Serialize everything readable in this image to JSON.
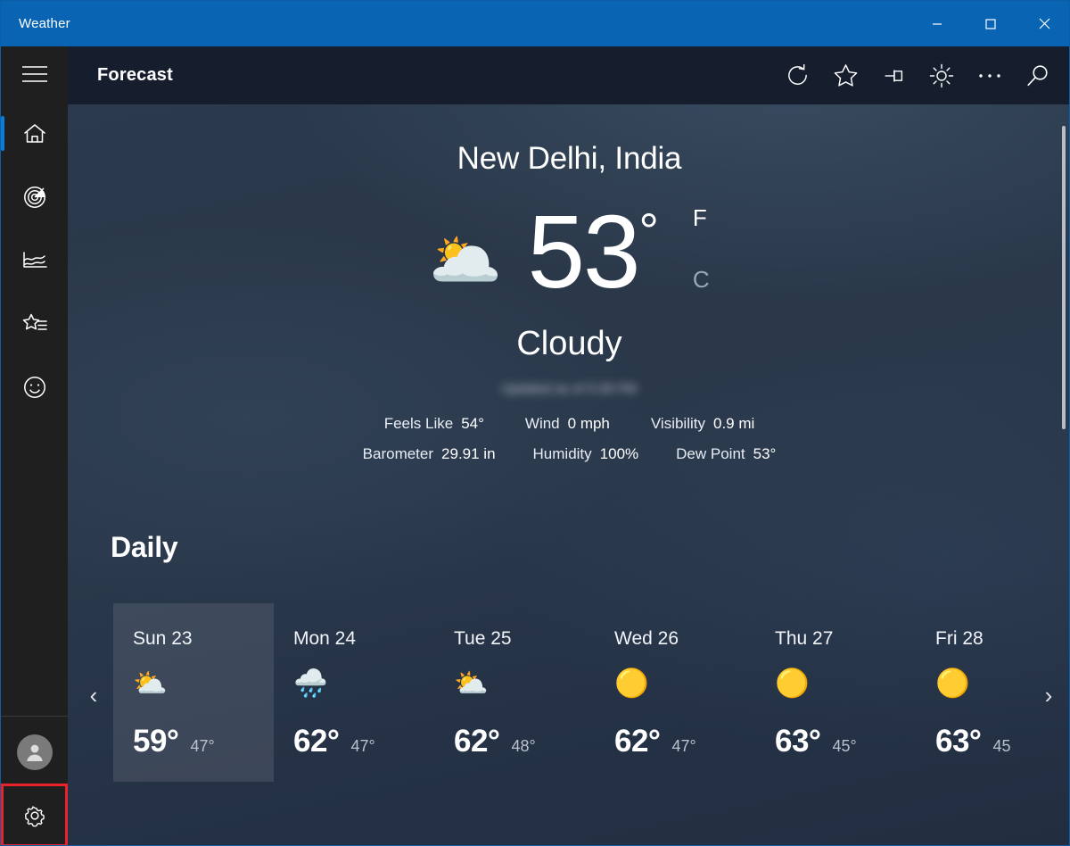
{
  "window": {
    "title": "Weather",
    "controls": [
      {
        "name": "minimize-button",
        "label": "—"
      },
      {
        "name": "maximize-button",
        "label": "□"
      },
      {
        "name": "close-button",
        "label": "✕"
      }
    ]
  },
  "rail": {
    "menu_label": "Menu",
    "items": [
      {
        "icon": "home-icon",
        "label": "Forecast",
        "active": true
      },
      {
        "icon": "radar-icon",
        "label": "Maps",
        "active": false
      },
      {
        "icon": "chart-icon",
        "label": "Historical Weather",
        "active": false
      },
      {
        "icon": "favorites-icon",
        "label": "Favorites",
        "active": false
      },
      {
        "icon": "news-icon",
        "label": "News",
        "active": false
      }
    ],
    "bottom": [
      {
        "icon": "account-icon",
        "label": "Account",
        "highlighted": false
      },
      {
        "icon": "settings-gear-icon",
        "label": "Settings",
        "highlighted": true
      }
    ],
    "highlight_color": "#e8232a",
    "active_indicator_color": "#0a7ddb"
  },
  "header": {
    "title": "Forecast",
    "actions": [
      {
        "icon": "refresh-icon",
        "label": "Refresh"
      },
      {
        "icon": "star-icon",
        "label": "Add to Favorites"
      },
      {
        "icon": "pin-icon",
        "label": "Pin to Start"
      },
      {
        "icon": "sun-icon",
        "label": "Change Background"
      },
      {
        "icon": "ellipsis-icon",
        "label": "See more"
      },
      {
        "icon": "search-icon",
        "label": "Search"
      }
    ]
  },
  "current": {
    "city": "New Delhi, India",
    "condition_icon": "🌥️",
    "temperature": "53",
    "degree": "°",
    "unit_f": "F",
    "unit_c": "C",
    "active_unit": "F",
    "condition": "Cloudy",
    "updated": "Updated as of 5:39 PM",
    "details_row1": [
      {
        "key": "Feels Like",
        "value": "54°"
      },
      {
        "key": "Wind",
        "value": "0 mph"
      },
      {
        "key": "Visibility",
        "value": "0.9 mi"
      }
    ],
    "details_row2": [
      {
        "key": "Barometer",
        "value": "29.91 in"
      },
      {
        "key": "Humidity",
        "value": "100%"
      },
      {
        "key": "Dew Point",
        "value": "53°"
      }
    ]
  },
  "daily": {
    "heading": "Daily",
    "prev_label": "‹",
    "next_label": "›",
    "cards": [
      {
        "day": "Sun 23",
        "icon": "⛅",
        "high": "59°",
        "low": "47°",
        "selected": true
      },
      {
        "day": "Mon 24",
        "icon": "🌧️",
        "high": "62°",
        "low": "47°",
        "selected": false
      },
      {
        "day": "Tue 25",
        "icon": "⛅",
        "high": "62°",
        "low": "48°",
        "selected": false
      },
      {
        "day": "Wed 26",
        "icon": "🟡",
        "high": "62°",
        "low": "47°",
        "selected": false
      },
      {
        "day": "Thu 27",
        "icon": "🟡",
        "high": "63°",
        "low": "45°",
        "selected": false
      },
      {
        "day": "Fri 28",
        "icon": "🟡",
        "high": "63°",
        "low": "45",
        "selected": false
      }
    ]
  },
  "colors": {
    "titlebar": "#0a64b4",
    "rail": "#1f1f1f",
    "app_header": "#161e2e",
    "accent": "#0a7ddb"
  }
}
